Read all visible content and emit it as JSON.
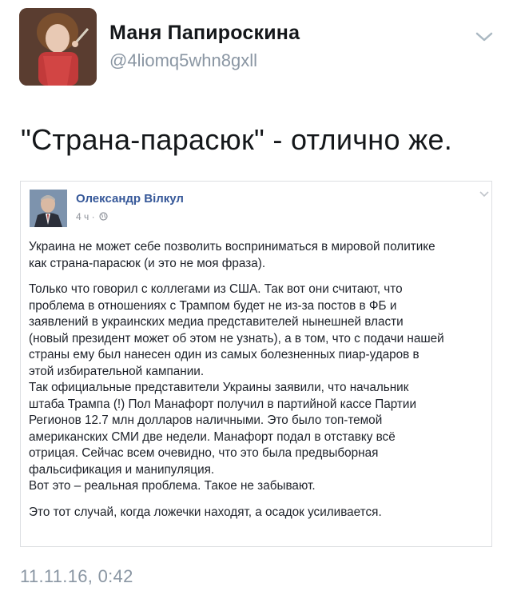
{
  "tweet": {
    "author_name": "Маня Папироскина",
    "author_handle": "@4liomq5whn8gxll",
    "avatar_icon": "profile-photo",
    "text": "\"Страна-парасюк\" - отлично же.",
    "date": "11.11.16, 0:42"
  },
  "embedded_post": {
    "author_name": "Олександр Вілкул",
    "time": "4 ч ·",
    "avatar_icon": "profile-photo",
    "paragraphs": [
      "Украина не может себе позволить восприниматься в мировой политике\nкак страна-парасюк (и это не моя фраза).",
      "Только что говорил с коллегами из США. Так вот они считают, что\nпроблема в отношениях с Трампом будет не из-за постов в ФБ и\nзаявлений в украинских медиа представителей нынешней власти\n(новый президент может об этом не узнать), а в том, что с подачи нашей\nстраны ему был нанесен один из самых болезненных пиар-ударов в\nэтой избирательной кампании.\nТак официальные представители Украины заявили, что начальник\nштаба Трампа (!) Пол Манафорт получил в партийной кассе Партии\nРегионов 12.7 млн долларов наличными. Это было топ-темой\nамериканских СМИ две недели. Манафорт подал в отставку всё\nотрицая. Сейчас всем очевидно, что это была предвыборная\nфальсификация и манипуляция.\nВот это – реальная проблема. Такое не забывают.",
      "Это тот случай, когда ложечки находят, а осадок усиливается."
    ]
  },
  "colors": {
    "name": "#14171a",
    "muted": "#8a96a3",
    "fb_link": "#365899",
    "fb_text": "#1d2129",
    "fb_border": "#dddfe2"
  }
}
